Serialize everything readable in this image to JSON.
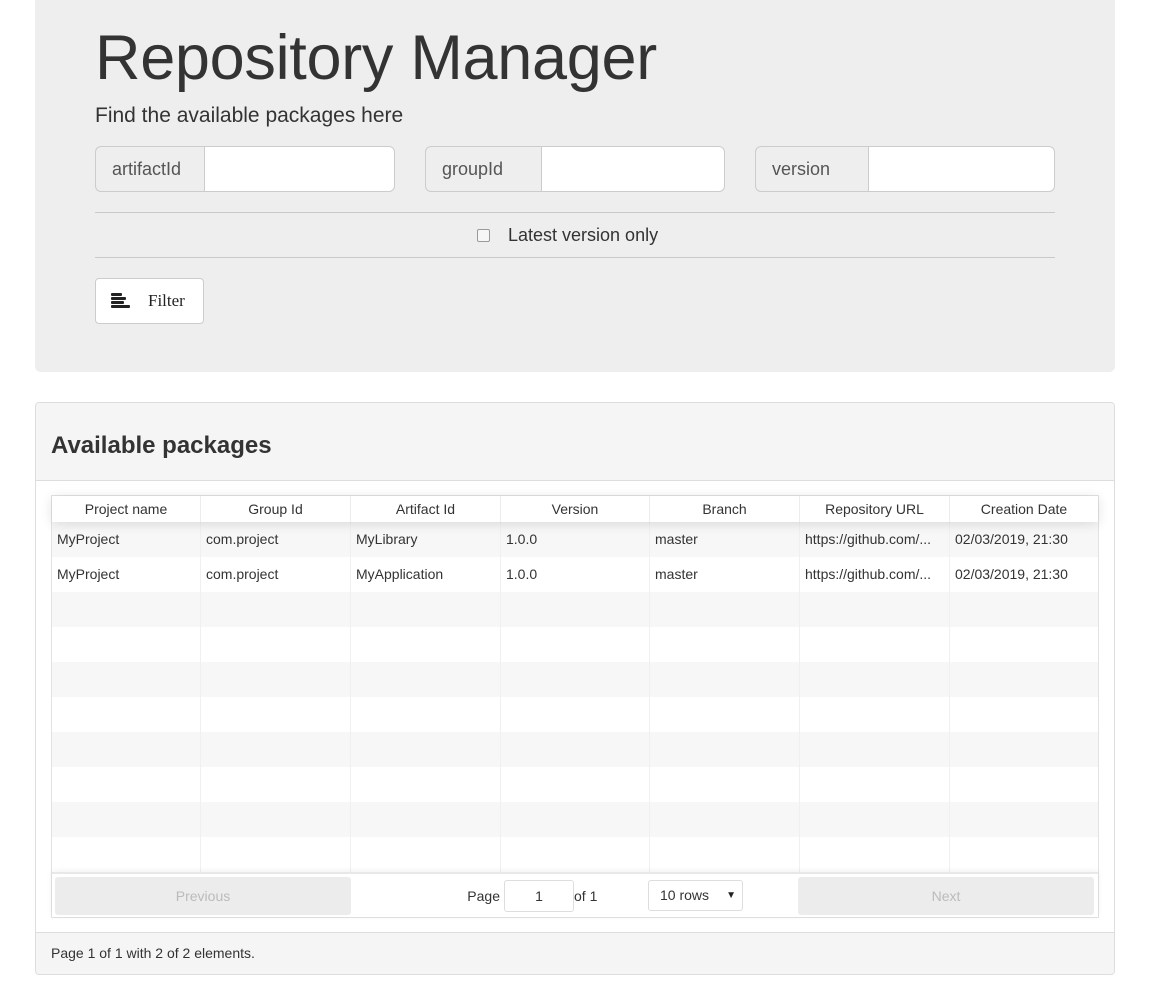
{
  "header": {
    "title": "Repository Manager",
    "subtitle": "Find the available packages here"
  },
  "filters": {
    "artifact_label": "artifactId",
    "artifact_value": "",
    "group_label": "groupId",
    "group_value": "",
    "version_label": "version",
    "version_value": "",
    "latest_only_label": "Latest version only",
    "latest_only_checked": false,
    "filter_button_label": "Filter",
    "filter_icon": "align-left-icon"
  },
  "panel": {
    "title": "Available packages",
    "footer_text": "Page 1 of 1 with 2 of 2 elements."
  },
  "table": {
    "columns": [
      "Project name",
      "Group Id",
      "Artifact Id",
      "Version",
      "Branch",
      "Repository URL",
      "Creation Date"
    ],
    "rows": [
      [
        "MyProject",
        "com.project",
        "MyLibrary",
        "1.0.0",
        "master",
        "https://github.com/...",
        "02/03/2019, 21:30"
      ],
      [
        "MyProject",
        "com.project",
        "MyApplication",
        "1.0.0",
        "master",
        "https://github.com/...",
        "02/03/2019, 21:30"
      ],
      [
        "",
        "",
        "",
        "",
        "",
        "",
        ""
      ],
      [
        "",
        "",
        "",
        "",
        "",
        "",
        ""
      ],
      [
        "",
        "",
        "",
        "",
        "",
        "",
        ""
      ],
      [
        "",
        "",
        "",
        "",
        "",
        "",
        ""
      ],
      [
        "",
        "",
        "",
        "",
        "",
        "",
        ""
      ],
      [
        "",
        "",
        "",
        "",
        "",
        "",
        ""
      ],
      [
        "",
        "",
        "",
        "",
        "",
        "",
        ""
      ],
      [
        "",
        "",
        "",
        "",
        "",
        "",
        ""
      ]
    ]
  },
  "pagination": {
    "previous_label": "Previous",
    "next_label": "Next",
    "page_label": "Page",
    "page_value": "1",
    "of_label": "of 1",
    "rows_option": "10 rows"
  },
  "colors": {
    "jumbotron_bg": "#eeeeee",
    "panel_heading_bg": "#f5f5f5",
    "text": "#333333",
    "disabled_button_bg": "#ececec"
  }
}
